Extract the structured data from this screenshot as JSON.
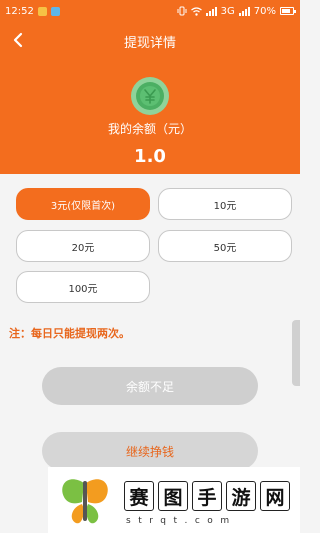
{
  "status_bar": {
    "time": "12:52",
    "network": "3G",
    "battery": "70%",
    "icons": [
      "app-notification-icon",
      "app-notification-icon-2",
      "vibrate-icon",
      "wifi-icon",
      "signal-icon",
      "battery-icon"
    ]
  },
  "header": {
    "title": "提现详情",
    "back_icon": "chevron-left-icon"
  },
  "balance": {
    "icon": "coin-icon",
    "label": "我的余额（元）",
    "value": "1.0"
  },
  "amount_options": [
    {
      "label": "3元(仅限首次)",
      "selected": true
    },
    {
      "label": "10元",
      "selected": false
    },
    {
      "label": "20元",
      "selected": false
    },
    {
      "label": "50元",
      "selected": false
    },
    {
      "label": "100元",
      "selected": false
    }
  ],
  "note": "注：每日只能提现两次。",
  "buttons": {
    "insufficient": "余额不足",
    "continue": "继续挣钱"
  },
  "watermark": {
    "chars": [
      "赛",
      "图",
      "手",
      "游",
      "网"
    ],
    "url": "strqt.com"
  },
  "colors": {
    "accent": "#f36d1e",
    "note": "#e8661c",
    "disabled": "#cfcfcf"
  }
}
